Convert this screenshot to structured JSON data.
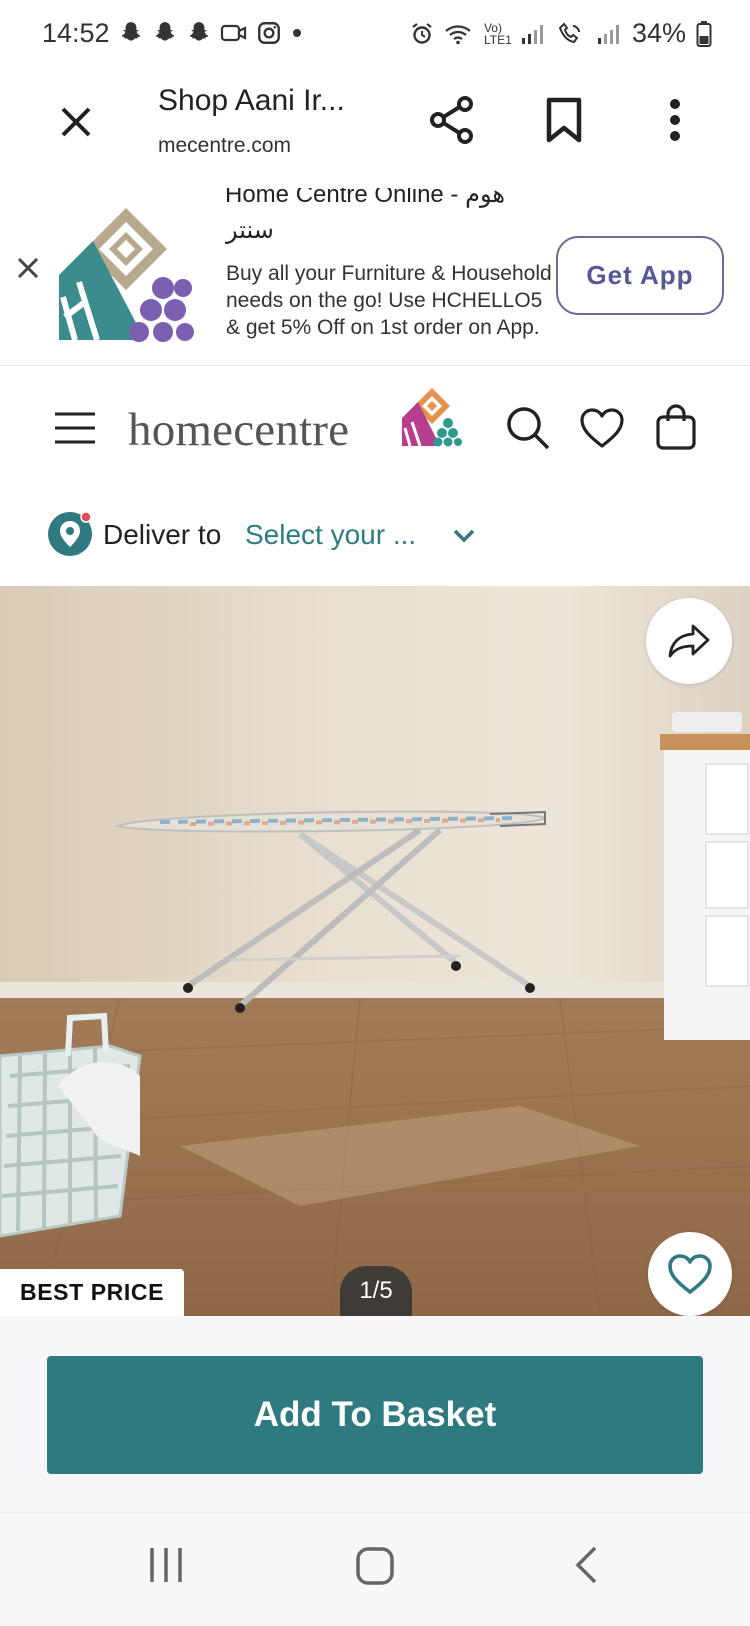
{
  "status_bar": {
    "time": "14:52",
    "signal_text": "Vo) LTE1",
    "battery": "34%"
  },
  "browser": {
    "title": "Shop Aani Ir...",
    "url": "mecentre.com"
  },
  "app_banner": {
    "heading_cut": "Home Centre Online - هوم",
    "heading_arabic": "سنتر",
    "description": "Buy all your Furniture & Household needs on the go! Use HCHELLO5 & get 5% Off on 1st order on App.",
    "get_app_label": "Get App"
  },
  "header": {
    "logo_text": "homecentre"
  },
  "delivery": {
    "label": "Deliver to",
    "select_text": "Select your ..."
  },
  "product": {
    "badge": "BEST PRICE",
    "image_counter": "1/5"
  },
  "actions": {
    "add_to_basket": "Add To Basket"
  },
  "colors": {
    "accent": "#2e7a80",
    "banner_button": "#565894",
    "logo_purple": "#7b5fb0",
    "logo_orange": "#e7924a"
  },
  "icons": [
    "close-icon",
    "share-icon",
    "bookmark-icon",
    "more-vert-icon",
    "menu-icon",
    "search-icon",
    "heart-icon",
    "bag-icon",
    "location-pin-icon",
    "chevron-down-icon",
    "forward-share-icon"
  ]
}
